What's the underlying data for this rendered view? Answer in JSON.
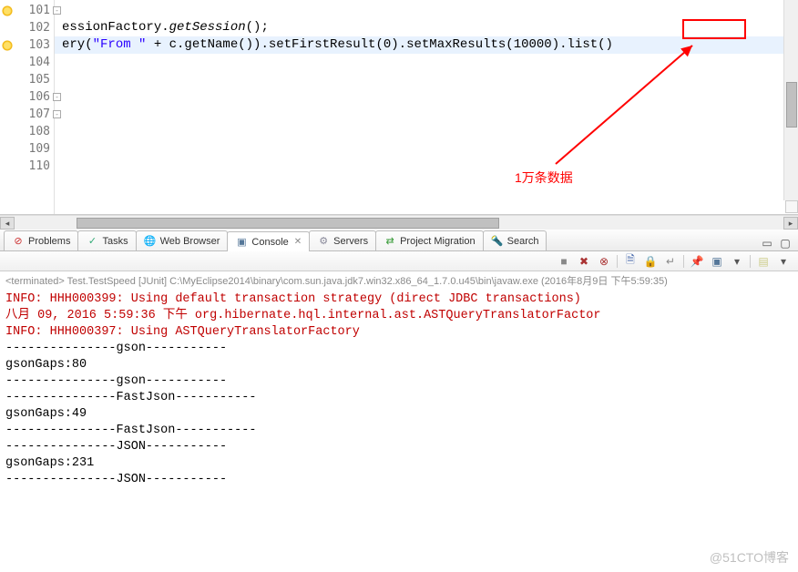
{
  "editor": {
    "lines": [
      {
        "num": "101",
        "icon": "lightbulb",
        "fold": true,
        "content": ""
      },
      {
        "num": "102",
        "content_html": "essionFactory.<span class='mtd'>getSession</span>();"
      },
      {
        "num": "103",
        "icon": "lightbulb",
        "highlight": true,
        "content_html": "ery(<span class='str'>\"From \"</span> + c.getName()).setFirstResult(<span class='num'>0</span>).setMaxResults(<span class='num'>10000</span>).list()"
      },
      {
        "num": "104"
      },
      {
        "num": "105"
      },
      {
        "num": "106",
        "fold": true
      },
      {
        "num": "107",
        "fold": true
      },
      {
        "num": "108"
      },
      {
        "num": "109"
      },
      {
        "num": "110"
      }
    ],
    "annotation": "1万条数据"
  },
  "tabs": [
    {
      "label": "Problems",
      "icon": "⊘",
      "icon_color": "#c33"
    },
    {
      "label": "Tasks",
      "icon": "✓",
      "icon_color": "#3a7"
    },
    {
      "label": "Web Browser",
      "icon": "🌐",
      "icon_color": "#39c"
    },
    {
      "label": "Console",
      "icon": "▣",
      "icon_color": "#579",
      "active": true,
      "closable": true
    },
    {
      "label": "Servers",
      "icon": "⚙",
      "icon_color": "#889"
    },
    {
      "label": "Project Migration",
      "icon": "⇄",
      "icon_color": "#393"
    },
    {
      "label": "Search",
      "icon": "🔦",
      "icon_color": "#c90"
    }
  ],
  "console": {
    "terminated": "<terminated> Test.TestSpeed [JUnit] C:\\MyEclipse2014\\binary\\com.sun.java.jdk7.win32.x86_64_1.7.0.u45\\bin\\javaw.exe (2016年8月9日 下午5:59:35)",
    "lines": [
      {
        "cls": "red",
        "text": "INFO: HHH000399: Using default transaction strategy (direct JDBC transactions)"
      },
      {
        "cls": "red",
        "text": "八月 09, 2016 5:59:36 下午 org.hibernate.hql.internal.ast.ASTQueryTranslatorFactor"
      },
      {
        "cls": "red",
        "text": "INFO: HHH000397: Using ASTQueryTranslatorFactory"
      },
      {
        "cls": "blk",
        "text": "---------------gson-----------"
      },
      {
        "cls": "blk",
        "text": "gsonGaps:80"
      },
      {
        "cls": "blk",
        "text": "---------------gson-----------"
      },
      {
        "cls": "blk",
        "text": "---------------FastJson-----------"
      },
      {
        "cls": "blk",
        "text": "gsonGaps:49"
      },
      {
        "cls": "blk",
        "text": "---------------FastJson-----------"
      },
      {
        "cls": "blk",
        "text": "---------------JSON-----------"
      },
      {
        "cls": "blk",
        "text": "gsonGaps:231"
      },
      {
        "cls": "blk",
        "text": "---------------JSON-----------"
      }
    ]
  },
  "watermark": "@51CTO博客"
}
